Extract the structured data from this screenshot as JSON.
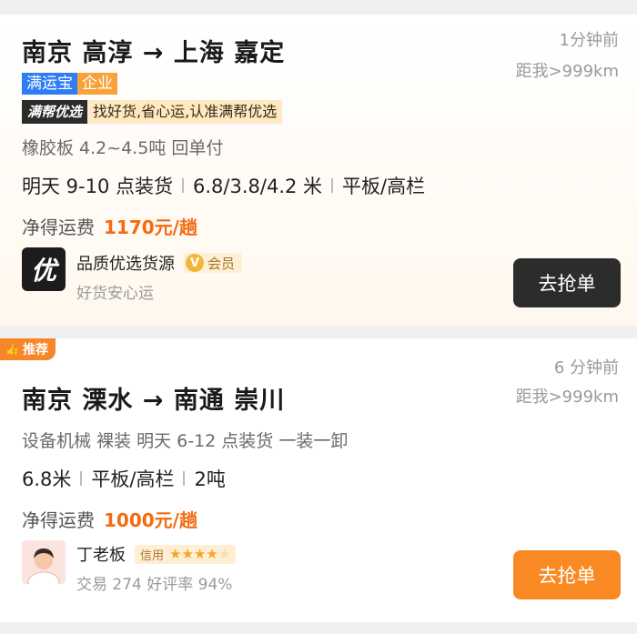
{
  "card1": {
    "route": "南京 高淳 → 上海 嘉定",
    "time": "1分钟前",
    "distance": "距我>999km",
    "badge_platform": "满运宝",
    "badge_enterprise": "企业",
    "badge_premium": "满帮优选",
    "badge_slogan": "找好货,省心运,认准满帮优选",
    "description": "橡胶板 4.2~4.5吨 回单付",
    "load_time": "明天 9-10 点装货",
    "truck_length": "6.8/3.8/4.2 米",
    "truck_type": "平板/高栏",
    "fee_label": "净得运费",
    "fee_amount": "1170元/趟",
    "logo_text": "优",
    "owner_name": "品质优选货源",
    "member_label": "会员",
    "member_icon": "V",
    "owner_sub": "好货安心运",
    "button": "去抢单"
  },
  "card2": {
    "recommend_tag": "推荐",
    "route": "南京 溧水 → 南通 崇川",
    "time": "6 分钟前",
    "distance": "距我>999km",
    "description": "设备机械 裸装 明天 6-12 点装货 一装一卸",
    "truck_length": "6.8米",
    "truck_type": "平板/高栏",
    "weight": "2吨",
    "fee_label": "净得运费",
    "fee_amount": "1000元/趟",
    "owner_name": "丁老板",
    "credit_label": "信用",
    "rating_stars": 3.5,
    "rating_max": 5,
    "owner_stats": "交易 274 好评率 94%",
    "button": "去抢单"
  },
  "colors": {
    "accent_orange": "#f36b10",
    "button_dark": "#2c2c2c",
    "button_orange": "#f98a23",
    "badge_blue": "#2f7cf6"
  },
  "icons": {
    "thumb": "thumbs-up-icon",
    "star": "star-icon"
  }
}
